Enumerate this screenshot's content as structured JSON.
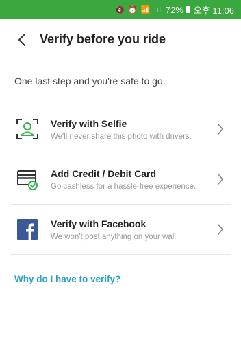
{
  "status_bar": {
    "icons": "🔇 ⏰ 📶 .ıl",
    "battery": "72%",
    "time": "오후 11:06"
  },
  "header": {
    "back_icon": "back-arrow-icon",
    "title": "Verify before you ride"
  },
  "intro": "One last step and you're safe to go.",
  "options": [
    {
      "icon": "selfie-face-scan-icon",
      "title": "Verify with Selfie",
      "subtitle": "We'll never share this photo with drivers."
    },
    {
      "icon": "credit-card-check-icon",
      "title": "Add Credit / Debit Card",
      "subtitle": "Go cashless for a hassle-free experience."
    },
    {
      "icon": "facebook-icon",
      "title": "Verify with Facebook",
      "subtitle": "We won't post anything on your wall."
    }
  ],
  "help_link": "Why do I have to verify?",
  "colors": {
    "status_bar": "#3aa83f",
    "accent_green": "#2fb34a",
    "link_blue": "#2a9fd0",
    "facebook_blue": "#3b5998"
  }
}
